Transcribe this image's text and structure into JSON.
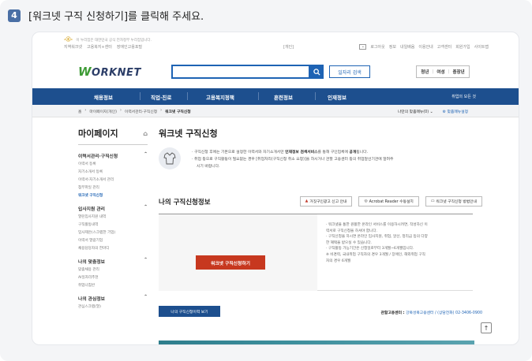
{
  "instruction": {
    "step_number": "4",
    "text": "[워크넷 구직 신청하기]를 클릭해 주세요."
  },
  "utility_bar": {
    "notice": "이 누리집은 대한민국 공식 전자정부 누리집입니다.",
    "left_links": [
      "지역워크넷",
      "고용복지+센터",
      "장애인고용포털"
    ],
    "center_label": "[개인]",
    "right_links": [
      "로그아웃",
      "정보",
      "내일배움",
      "이용안내",
      "고객센터",
      "회원가입",
      "사이트맵"
    ]
  },
  "header": {
    "logo_text": "ORKNET",
    "logo_w": "W",
    "search_placeholder": "",
    "job_search_label": "일자리 검색",
    "audience_links": [
      "청년",
      "여성",
      "중장년"
    ]
  },
  "gnb": {
    "items": [
      "채용정보",
      "직업·진로",
      "고용복지정책",
      "훈련정보",
      "인재정보"
    ],
    "right_label": "취업의 모든 것"
  },
  "breadcrumb": {
    "items": [
      "홈",
      "마이페이지(개인)",
      "이력서관리·구직신청",
      "워크넷 구직신청"
    ],
    "right_menu": "나만의 맞춤메뉴(0)",
    "right_setting": "맞춤메뉴설정"
  },
  "sidebar": {
    "title": "마이페이지",
    "groups": [
      {
        "head": "이력서관리·구직신청",
        "links": [
          "이력서 등록",
          "자기소개서 등록",
          "이력서·자기소개서 관리",
          "첨부파일 관리",
          "워크넷 구직신청"
        ]
      },
      {
        "head": "입사지원 관리",
        "links": [
          "열린입사지원 내역",
          "구직활동내역",
          "입사제안(스크랩한 기업)",
          "이력서 열람기업",
          "채용담당자의 한마디"
        ]
      },
      {
        "head": "나의 맞춤정보",
        "links": [
          "맞춤채용 관리",
          "AI일자리추천",
          "취업나침반"
        ]
      },
      {
        "head": "나의 관심정보",
        "links": [
          "관심스크랩(열)"
        ]
      }
    ]
  },
  "main": {
    "page_title": "워크넷 구직신청",
    "info_line1_pre": "구직신청 후에는 기본으로 설정한 이력서와 자기소개서만 ",
    "info_line1_bold1": "인재정보 검색서비스",
    "info_line1_mid": "를 통해 구인업체에 ",
    "info_line1_bold2": "공개",
    "info_line1_post": "됩니다.",
    "info_line2": "취업 등으로 구직활동이 필요없는 경우 [취업처리(구직신청 취소 요청)]을 하시거나 관할 고용센터 등의 취업알선기관에 알려주",
    "info_line3": "시기 바랍니다.",
    "section_title": "나의 구직신청정보",
    "btn_report": "거짓구인광고 신고 안내",
    "btn_acrobat": "Acrobat Reader 수동설치",
    "btn_guide": "워크넷 구직신청 방법안내",
    "apply_label": "워크넷 구직신청하기",
    "notes": [
      "· 워크넷을 통한 원활한 온라인 서비스를 이용하시려면, 작성하신 이",
      "  력서로 구직신청을 하셔야 합니다.",
      "· 구직신청을 하시면 온라인 입사지원, 취업, 알선, 정리금 등의 다양",
      "  한 혜택을 받으실 수 있습니다.",
      "· 구직활동 가능기간은 신청일로부터 3개월~6개월입니다.",
      "  ※ 비경력, 국내취업 구직자의 경우 3개월 / 장애인, 해외취업 구직",
      "  자의 경우 6개월"
    ],
    "history_label": "나의 구직신청이력 보기",
    "center_bold": "관할고용센터 :",
    "center_name": "강북성북고용센터 / (상담전화) 02-3406-0900"
  },
  "top_button": "↑"
}
